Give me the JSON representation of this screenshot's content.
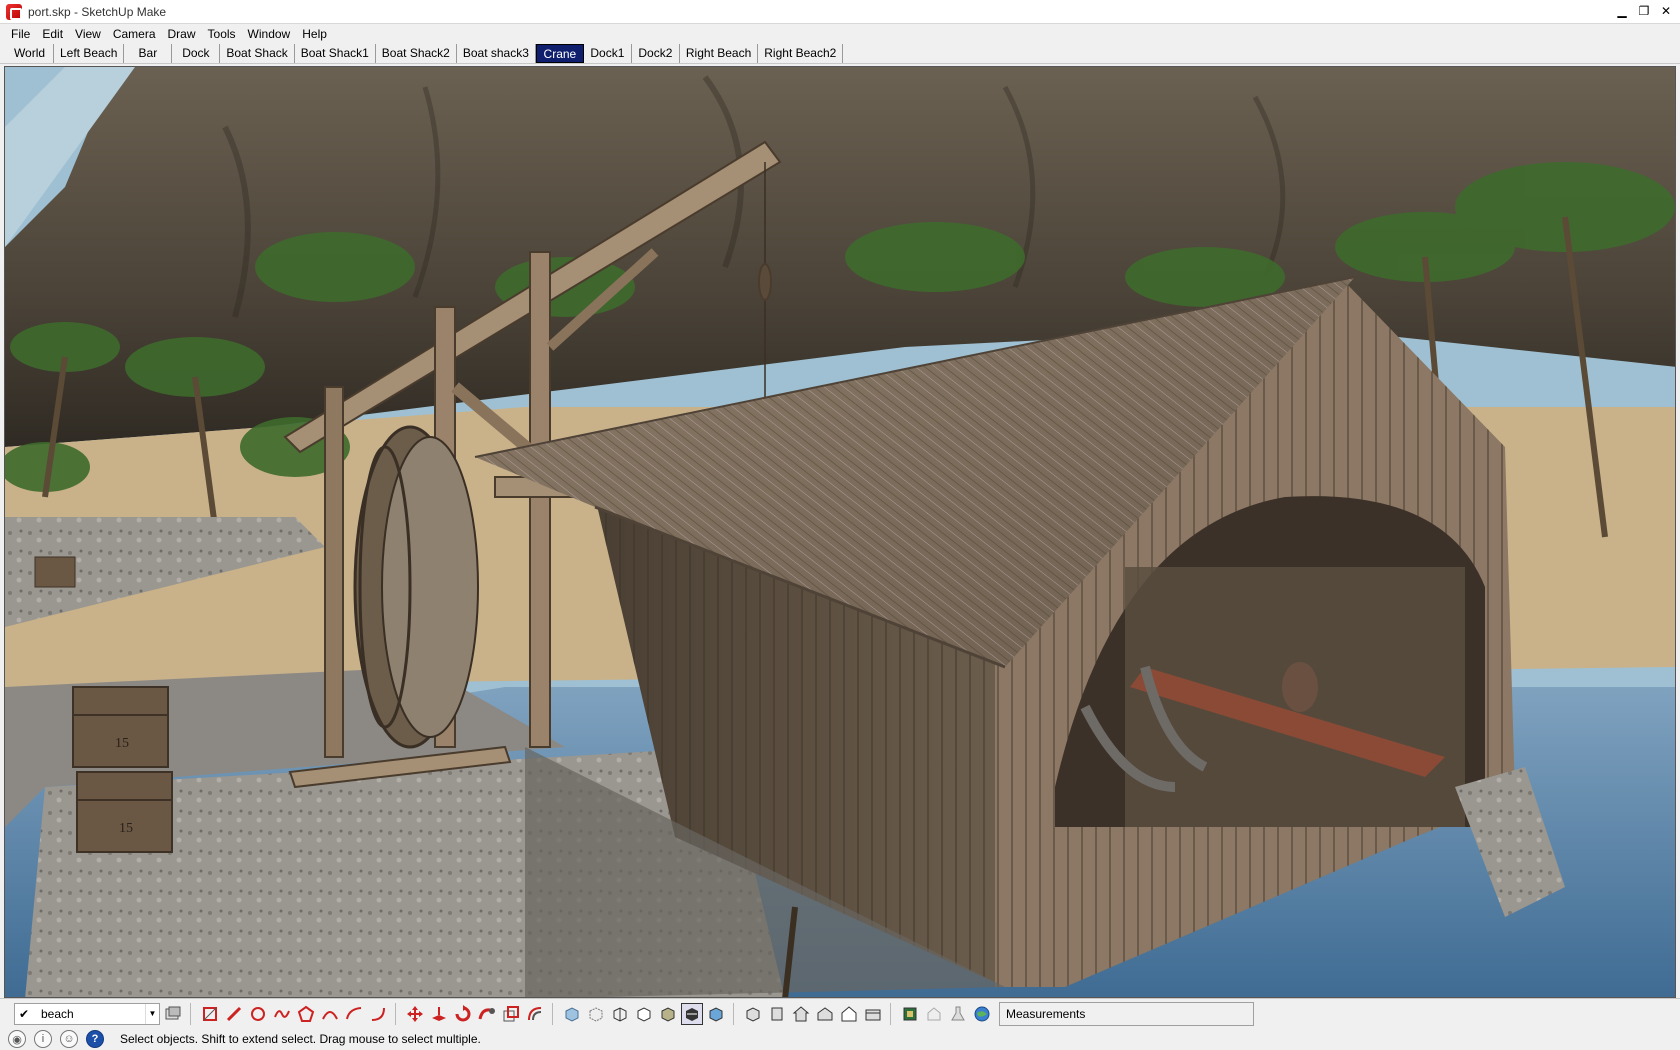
{
  "window": {
    "title": "port.skp - SketchUp Make"
  },
  "menu": [
    "File",
    "Edit",
    "View",
    "Camera",
    "Draw",
    "Tools",
    "Window",
    "Help"
  ],
  "scenes": {
    "tabs": [
      "World",
      "Left Beach",
      "Bar",
      "Dock",
      "Boat Shack",
      "Boat Shack1",
      "Boat Shack2",
      "Boat shack3",
      "Crane",
      "Dock1",
      "Dock2",
      "Right Beach",
      "Right Beach2"
    ],
    "active": "Crane"
  },
  "crates": {
    "label": "15"
  },
  "layer": {
    "current": "beach"
  },
  "measurements": {
    "label": "Measurements"
  },
  "status": {
    "hint": "Select objects. Shift to extend select. Drag mouse to select multiple."
  },
  "colors": {
    "active_tab": "#0f1f6e",
    "sky": "#8fb3c8",
    "wood": "#8a7560",
    "sand": "#c9b28a"
  },
  "toolbar_icons": {
    "drawing": [
      "rectangle-icon",
      "pencil-icon",
      "circle-icon",
      "freehand-icon",
      "polygon-icon",
      "arc-icon",
      "arc2-icon",
      "arc3-icon"
    ],
    "edit": [
      "move-icon",
      "push-pull-icon",
      "rotate-icon",
      "follow-me-icon",
      "scale-icon",
      "offset-icon"
    ],
    "style": [
      "xray-icon",
      "back-edges-icon",
      "wireframe-icon",
      "hidden-line-icon",
      "shaded-icon",
      "shaded-textures-icon",
      "monochrome-icon"
    ],
    "views": [
      "iso-icon",
      "top-icon",
      "front-icon",
      "right-icon",
      "back-icon",
      "left-icon"
    ],
    "warehouse": [
      "warehouse-icon",
      "share-model-icon",
      "extension-icon",
      "geo-location-icon"
    ]
  }
}
